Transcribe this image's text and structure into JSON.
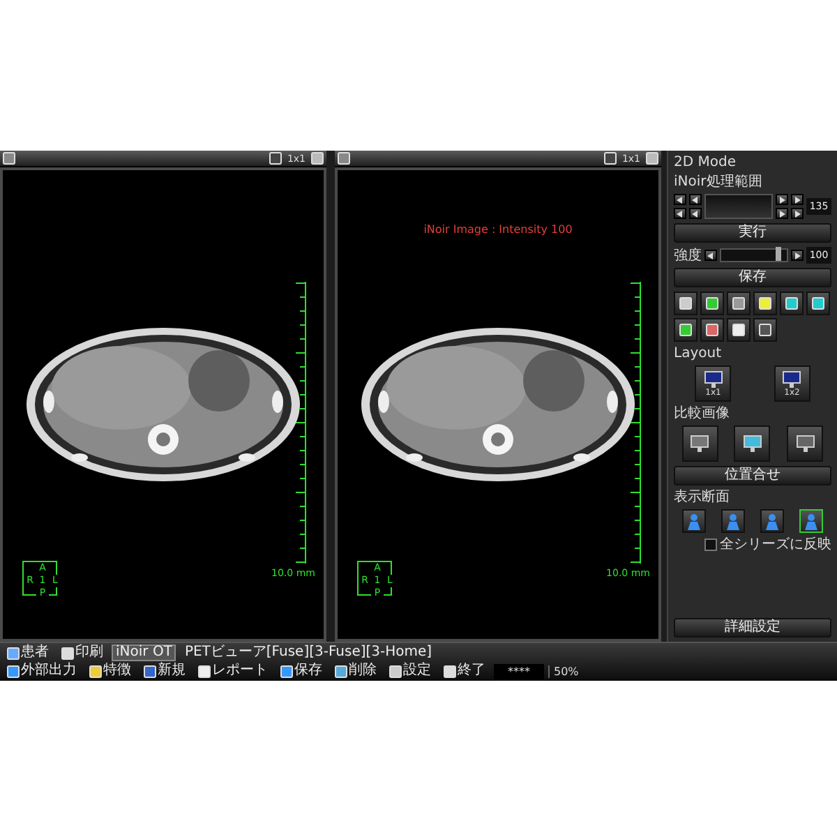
{
  "viewers": [
    {
      "header_label": "1x1",
      "scale_label": "10.0 mm",
      "orientation": {
        "top": "A",
        "left": "R",
        "center": "1",
        "right": "L",
        "bottom": "P"
      }
    },
    {
      "header_label": "1x1",
      "overlay_text": "iNoir Image : Intensity 100",
      "scale_label": "10.0 mm",
      "orientation": {
        "top": "A",
        "left": "R",
        "center": "1",
        "right": "L",
        "bottom": "P"
      }
    }
  ],
  "panel": {
    "mode_title": "2D Mode",
    "range_label": "iNoir処理範囲",
    "range_value": "135",
    "run_button": "実行",
    "strength": {
      "label": "強度",
      "level": 0.88,
      "value": "100"
    },
    "save_button": "保存",
    "layout_label": "Layout",
    "layouts": [
      {
        "label": "1x1"
      },
      {
        "label": "1x2"
      }
    ],
    "compare_label": "比較画像",
    "align_button": "位置合せ",
    "section_label": "表示断面",
    "sections": [
      {
        "selected": false
      },
      {
        "selected": false
      },
      {
        "selected": false
      },
      {
        "selected": true
      }
    ],
    "apply_all": {
      "label": "全シリーズに反映",
      "checked": false
    },
    "detail_button": "詳細設定"
  },
  "taskbar": {
    "left": [
      {
        "label": "患者",
        "kind": "button",
        "selected": false
      },
      {
        "label": "印刷",
        "kind": "button",
        "selected": false
      },
      {
        "label": "iNoir OT",
        "kind": "tab",
        "selected": true
      },
      {
        "label": "PETビューア[Fuse][3-Fuse][3-Home]",
        "kind": "tab",
        "selected": false
      }
    ],
    "right": [
      {
        "label": "外部出力"
      },
      {
        "label": "特徴"
      },
      {
        "label": "新規"
      },
      {
        "label": "レポート"
      },
      {
        "label": "保存"
      },
      {
        "label": "削除"
      },
      {
        "label": "設定"
      },
      {
        "label": "終了"
      }
    ],
    "status": "****",
    "zoom": "50%"
  }
}
